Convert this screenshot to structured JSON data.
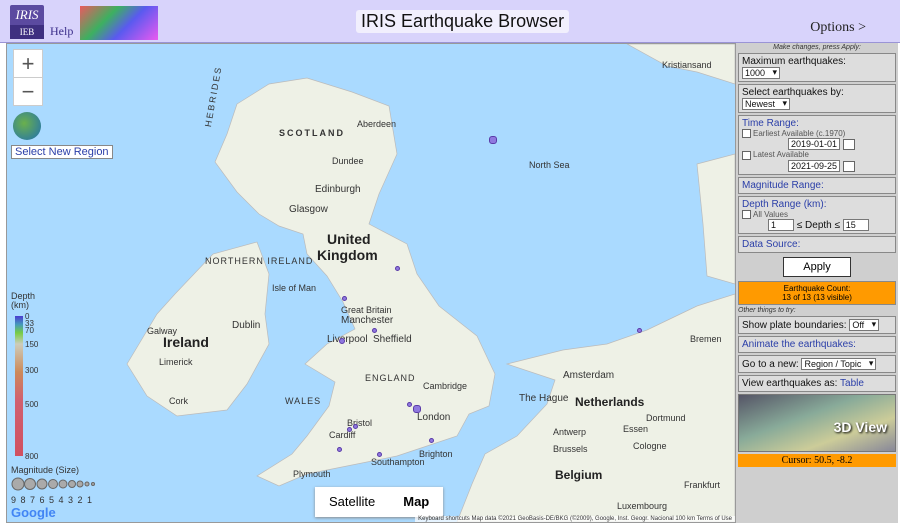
{
  "header": {
    "logo_top": "IRIS",
    "logo_bottom": "IEB",
    "help": "Help",
    "title": "IRIS Earthquake Browser",
    "options": "Options >"
  },
  "map": {
    "zoom_in": "+",
    "zoom_out": "−",
    "select_region": "Select New Region",
    "tab_satellite": "Satellite",
    "tab_map": "Map",
    "google": "Google",
    "attribution": "Keyboard shortcuts   Map data ©2021 GeoBasis-DE/BKG (©2009), Google, Inst. Geogr. Nacional   100 km   Terms of Use",
    "depth_legend": {
      "title": "Depth (km)",
      "ticks": [
        "0",
        "33",
        "70",
        "150",
        "300",
        "500",
        "800"
      ]
    },
    "magnitude_legend": {
      "title": "Magnitude (Size)",
      "values": "9 8 7 6 5 4 3 2 1"
    },
    "places": {
      "kristiansand": "Kristiansand",
      "aberdeen": "Aberdeen",
      "scotland": "SCOTLAND",
      "hebrides": "HEBRIDES",
      "dundee": "Dundee",
      "north_sea": "North Sea",
      "edinburgh": "Edinburgh",
      "glasgow": "Glasgow",
      "united": "United",
      "kingdom": "Kingdom",
      "northern_ireland": "NORTHERN IRELAND",
      "isle_of_man": "Isle of Man",
      "great_britain": "Great Britain",
      "manchester": "Manchester",
      "liverpool": "Liverpool",
      "sheffield": "Sheffield",
      "dublin": "Dublin",
      "galway": "Galway",
      "ireland": "Ireland",
      "limerick": "Limerick",
      "cork": "Cork",
      "england": "ENGLAND",
      "wales": "WALES",
      "cambridge": "Cambridge",
      "bristol": "Bristol",
      "cardiff": "Cardiff",
      "london": "London",
      "southampton": "Southampton",
      "brighton": "Brighton",
      "plymouth": "Plymouth",
      "amsterdam": "Amsterdam",
      "the_hague": "The Hague",
      "netherlands": "Netherlands",
      "bremen": "Bremen",
      "dortmund": "Dortmund",
      "essen": "Essen",
      "antwerp": "Antwerp",
      "brussels": "Brussels",
      "belgium": "Belgium",
      "cologne": "Cologne",
      "frankfurt": "Frankfurt",
      "luxembourg": "Luxembourg"
    }
  },
  "panel": {
    "note": "Make changes, press Apply:",
    "max_eq_label": "Maximum earthquakes:",
    "max_eq_value": "1000",
    "select_by_label": "Select earthquakes by:",
    "select_by_value": "Newest",
    "time_range": "Time Range:",
    "earliest": "Earliest Available (c.1970)",
    "start_date": "2019-01-01",
    "latest": "Latest Available",
    "end_date": "2021-09-25",
    "magnitude_range": "Magnitude Range:",
    "depth_range": "Depth Range (km):",
    "all_values": "All Values",
    "depth_min": "1",
    "depth_mid": "≤ Depth ≤",
    "depth_max": "15",
    "data_source": "Data Source:",
    "apply": "Apply",
    "count_title": "Earthquake Count:",
    "count_value": "13 of 13 (13 visible)",
    "other_things": "Other things to try:",
    "plate_label": "Show plate boundaries:",
    "plate_value": "Off",
    "animate": "Animate the earthquakes:",
    "goto_label": "Go to a new:",
    "goto_value": "Region / Topic",
    "view_as_label": "View earthquakes as:",
    "view_as_link": "Table",
    "cube_label": "3D View",
    "cursor": "Cursor: 50.5, -8.2"
  }
}
